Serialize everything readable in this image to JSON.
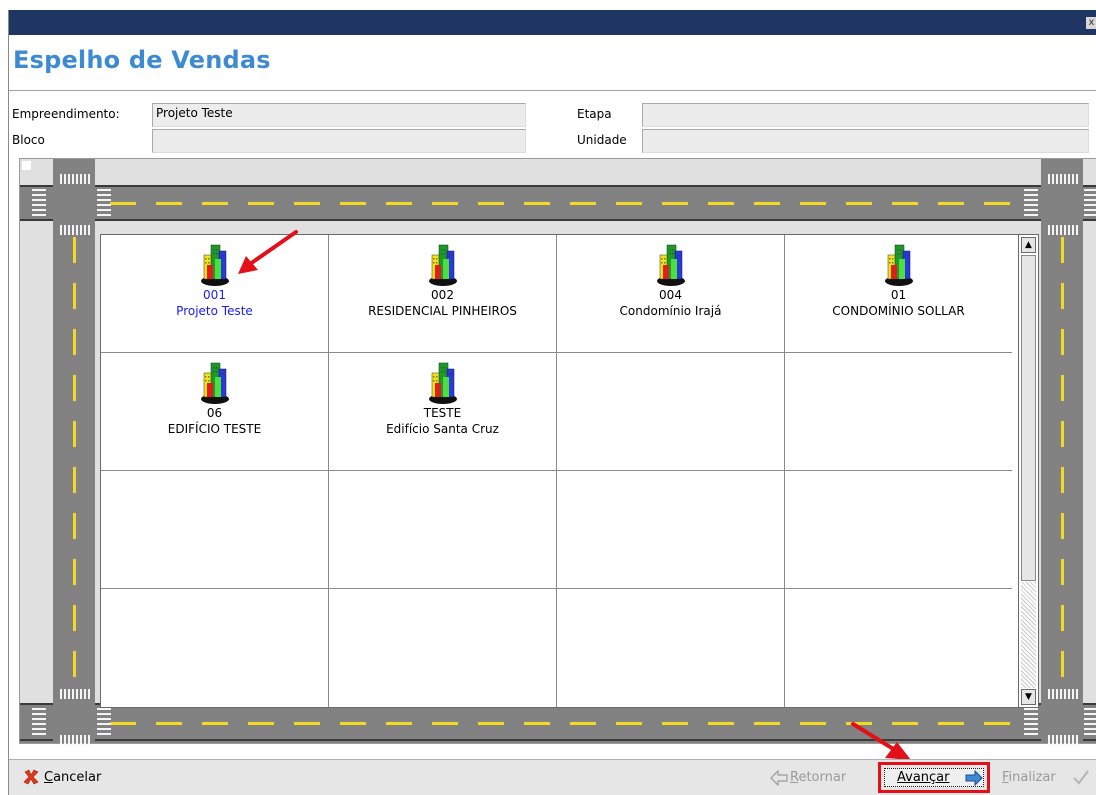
{
  "window": {
    "title": "Espelho de Vendas",
    "close_glyph": "x"
  },
  "form": {
    "empreendimento_label": "Empreendimento:",
    "empreendimento_value": "Projeto Teste",
    "bloco_label": "Bloco",
    "bloco_value": "",
    "etapa_label": "Etapa",
    "etapa_value": "",
    "unidade_label": "Unidade",
    "unidade_value": ""
  },
  "projects": [
    {
      "code": "001",
      "name": "Projeto Teste",
      "selected": true
    },
    {
      "code": "002",
      "name": "RESIDENCIAL PINHEIROS",
      "selected": false
    },
    {
      "code": "004",
      "name": "Condomínio Irajá",
      "selected": false
    },
    {
      "code": "01",
      "name": "CONDOMÍNIO SOLLAR",
      "selected": false
    },
    {
      "code": "06",
      "name": "EDIFÍCIO TESTE",
      "selected": false
    },
    {
      "code": "TESTE",
      "name": "Edifício Santa Cruz",
      "selected": false
    }
  ],
  "buttons": {
    "cancelar_rest": "ancelar",
    "cancelar_key": "C",
    "retornar_key": "R",
    "retornar_rest": "etornar",
    "avancar_key": "A",
    "avancar_rest": "vançar",
    "finalizar_key": "F",
    "finalizar_rest": "inalizar"
  },
  "colors": {
    "title": "#3d8ad4",
    "selected_text": "#1a1aff",
    "highlight_box": "#e3101a",
    "annotation_arrow": "#e3101a",
    "road": "#828282",
    "road_line": "#f2d923"
  },
  "icons": {
    "building": "building-icon",
    "cancel": "cancel-x-icon",
    "back": "arrow-left-icon",
    "next": "arrow-right-icon",
    "finish": "checkmark-icon"
  }
}
